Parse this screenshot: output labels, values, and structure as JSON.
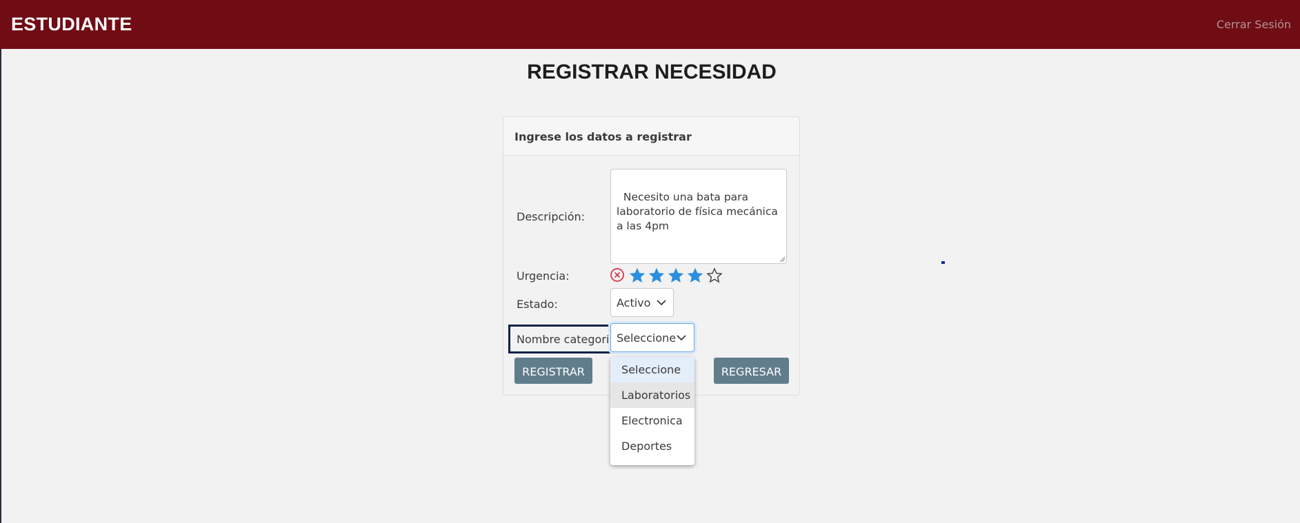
{
  "header": {
    "brand": "ESTUDIANTE",
    "logout": "Cerrar Sesión"
  },
  "page": {
    "title": "REGISTRAR NECESIDAD"
  },
  "form": {
    "header": "Ingrese los datos a registrar",
    "descripcion_label": "Descripción:",
    "descripcion_value": "Necesito una bata para laboratorio de física mecánica a las 4pm",
    "urgencia_label": "Urgencia:",
    "urgencia_rating": 4,
    "urgencia_max": 5,
    "estado_label": "Estado:",
    "estado_value": "Activo",
    "categoria_label": "Nombre categoría:",
    "categoria_value": "Seleccione",
    "categoria_options": [
      "Seleccione",
      "Laboratorios",
      "Electronica",
      "Deportes"
    ],
    "registrar_label": "REGISTRAR",
    "regresar_label": "REGRESAR"
  },
  "colors": {
    "navbar": "#700c14",
    "button": "#607d8b",
    "star": "#2b8fe0",
    "clear": "#d1364a"
  },
  "icons": {
    "clear": "circle-x-icon",
    "star_filled": "star-filled-icon",
    "star_empty": "star-outline-icon",
    "chevron": "chevron-down-icon"
  }
}
